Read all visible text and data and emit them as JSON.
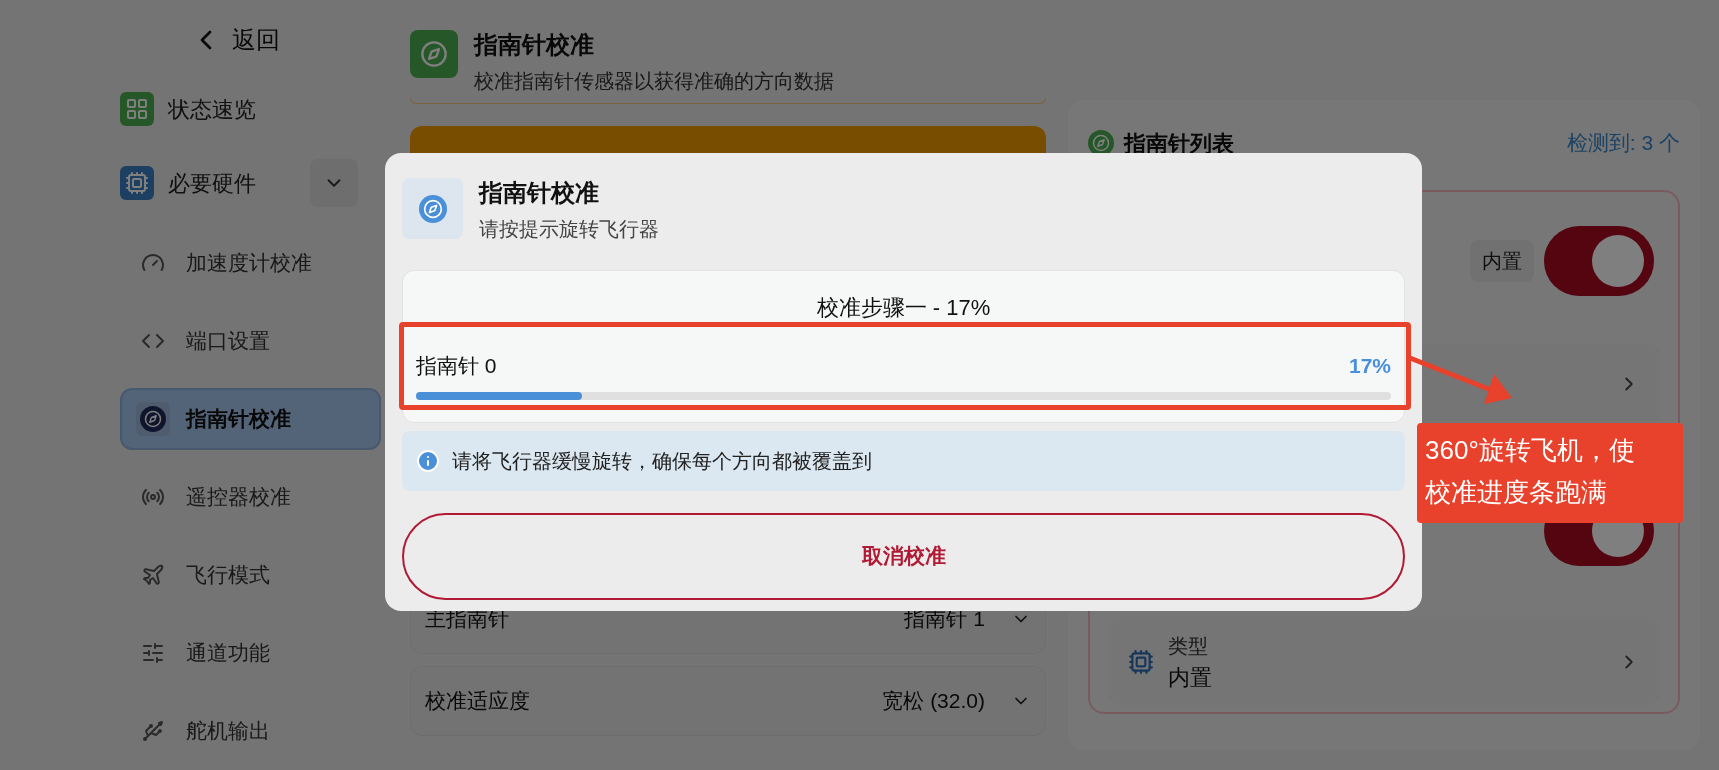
{
  "sidebar": {
    "back": "返回",
    "items": [
      {
        "label": "状态速览",
        "kind": "link",
        "selected": false
      },
      {
        "label": "必要硬件",
        "kind": "group",
        "selected": false,
        "expanded": true,
        "children": [
          {
            "label": "加速度计校准",
            "selected": false
          },
          {
            "label": "端口设置",
            "selected": false
          },
          {
            "label": "指南针校准",
            "selected": true
          },
          {
            "label": "遥控器校准",
            "selected": false
          },
          {
            "label": "飞行模式",
            "selected": false
          },
          {
            "label": "通道功能",
            "selected": false
          },
          {
            "label": "舵机输出",
            "selected": false
          }
        ]
      }
    ]
  },
  "page": {
    "title": "指南针校准",
    "subtitle": "校准指南针传感器以获得准确的方向数据",
    "settings": [
      {
        "label": "主指南针",
        "value": "指南针 1"
      },
      {
        "label": "校准适应度",
        "value": "宽松 (32.0)"
      }
    ]
  },
  "compass_list": {
    "title": "指南针列表",
    "count": "检测到: 3 个",
    "rows": [
      {
        "kind": "toggle",
        "tag": "内置",
        "on": true
      },
      {
        "kind": "link"
      },
      {
        "kind": "toggle",
        "on": true
      },
      {
        "kind": "info",
        "label": "类型",
        "value": "内置"
      }
    ]
  },
  "dialog": {
    "title": "指南针校准",
    "subtitle": "请按提示旋转飞行器",
    "step": "校准步骤一 - 17%",
    "sensors": [
      {
        "name": "指南针 0",
        "reading": "17%",
        "level": 0.17
      }
    ],
    "tip": "请将飞行器缓慢旋转，确保每个方向都被覆盖到",
    "cancel": "取消校准"
  },
  "annotation": {
    "text": "360°旋转飞机，使校准进度条跑满"
  }
}
